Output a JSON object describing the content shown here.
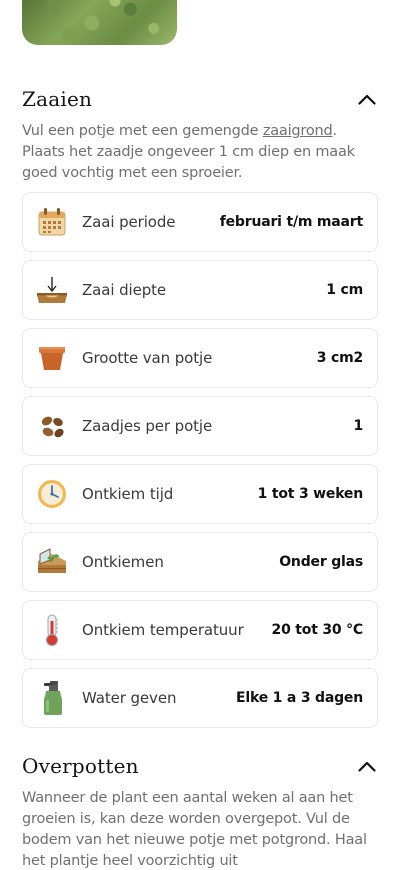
{
  "sections": {
    "zaaien": {
      "title": "Zaaien",
      "intro_pre": "Vul een potje met een gemengde ",
      "intro_link": "zaaigrond",
      "intro_post": ". Plaats het zaadje ongeveer 1 cm diep en maak goed vochtig met een sproeier."
    },
    "overpotten": {
      "title": "Overpotten",
      "intro": "Wanneer de plant een aantal weken al aan het groeien is, kan deze worden overgepot. Vul de bodem van het nieuwe potje met potgrond. Haal het plantje heel voorzichtig uit"
    }
  },
  "cards": [
    {
      "icon": "calendar-icon",
      "label": "Zaai periode",
      "value": "februari t/m maart"
    },
    {
      "icon": "sowing-depth-icon",
      "label": "Zaai diepte",
      "value": "1 cm"
    },
    {
      "icon": "pot-icon",
      "label": "Grootte van potje",
      "value": "3 cm2"
    },
    {
      "icon": "seeds-icon",
      "label": "Zaadjes per potje",
      "value": "1"
    },
    {
      "icon": "clock-icon",
      "label": "Ontkiem tijd",
      "value": "1 tot 3 weken"
    },
    {
      "icon": "greenhouse-icon",
      "label": "Ontkiemen",
      "value": "Onder glas"
    },
    {
      "icon": "thermometer-icon",
      "label": "Ontkiem temperatuur",
      "value": "20 tot 30 °C"
    },
    {
      "icon": "spray-bottle-icon",
      "label": "Water geven",
      "value": "Elke 1 a 3 dagen"
    }
  ]
}
